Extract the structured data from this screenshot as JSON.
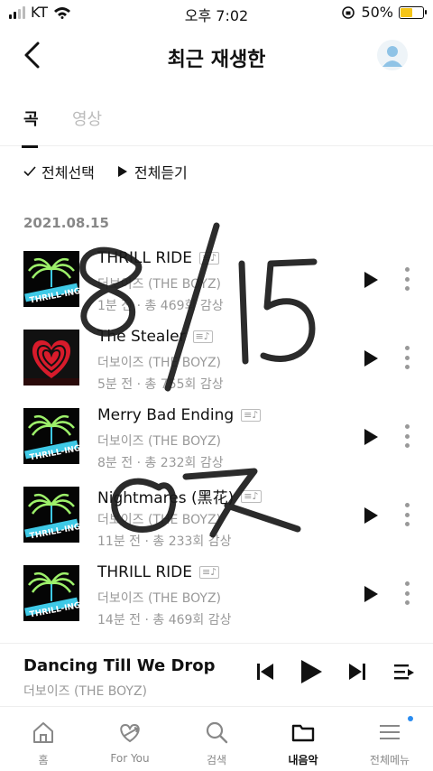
{
  "status": {
    "carrier": "KT",
    "time": "오후 7:02",
    "battery": "50%",
    "battery_level": 0.5
  },
  "header": {
    "title": "최근 재생한",
    "back_icon": "chevron-left-icon",
    "profile_icon": "avatar-icon"
  },
  "tabs": [
    {
      "label": "곡",
      "active": true
    },
    {
      "label": "영상",
      "active": false
    }
  ],
  "actions": {
    "select_all": "전체선택",
    "play_all": "전체듣기"
  },
  "date": "2021.08.15",
  "tracks": [
    {
      "title": "THRILL RIDE",
      "artist": "더보이즈 (THE BOYZ)",
      "meta": "1분 전 · 총 469회 감상",
      "cover": "thrill-ing"
    },
    {
      "title": "The Stealer",
      "artist": "더보이즈 (THE BOYZ)",
      "meta": "5분 전 · 총 755회 감상",
      "cover": "chase"
    },
    {
      "title": "Merry Bad Ending",
      "artist": "더보이즈 (THE BOYZ)",
      "meta": "8분 전 · 총 232회 감상",
      "cover": "thrill-ing"
    },
    {
      "title": "Nightmares (黑花)",
      "artist": "더보이즈 (THE BOYZ)",
      "meta": "11분 전 · 총 233회 감상",
      "cover": "thrill-ing"
    },
    {
      "title": "THRILL RIDE",
      "artist": "더보이즈 (THE BOYZ)",
      "meta": "14분 전 · 총 469회 감상",
      "cover": "thrill-ing"
    }
  ],
  "lyrics_badge": "≡♪",
  "player": {
    "title": "Dancing Till We Drop",
    "artist": "더보이즈 (THE BOYZ)"
  },
  "nav": [
    {
      "label": "홈",
      "icon": "home-icon"
    },
    {
      "label": "For You",
      "icon": "heart-arrow-icon"
    },
    {
      "label": "검색",
      "icon": "search-icon"
    },
    {
      "label": "내음악",
      "icon": "folder-icon",
      "active": true
    },
    {
      "label": "전체메뉴",
      "icon": "menu-icon"
    }
  ],
  "colors": {
    "accent": "#2a8cf0",
    "battery": "#f5c518",
    "muted": "#999999"
  }
}
